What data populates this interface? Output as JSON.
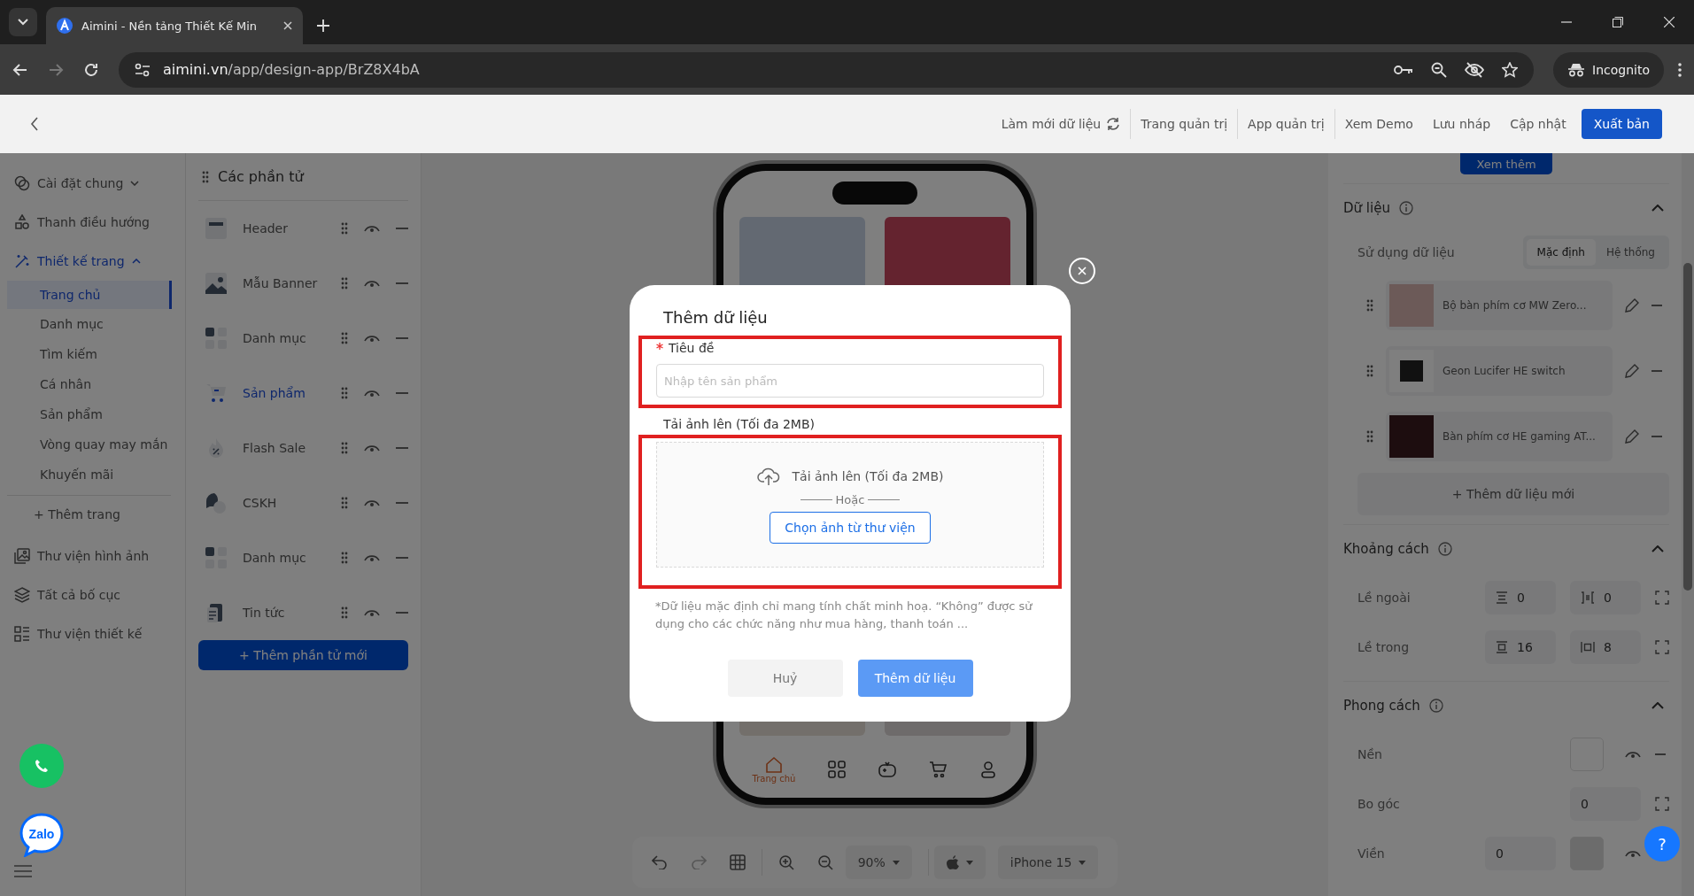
{
  "browser": {
    "tabs": [
      {
        "title": "Aimini - Nền tảng Thiết Kế Min",
        "selected": true
      }
    ],
    "url_host": "aimini.vn",
    "url_path": "/app/design-app/BrZ8X4bA",
    "profile": "Incognito"
  },
  "header": {
    "actions": [
      {
        "label": "Làm mới dữ liệu",
        "kind": "refresh",
        "divider": true
      },
      {
        "label": "Trang quản trị",
        "kind": "link",
        "divider": true
      },
      {
        "label": "App quản trị",
        "kind": "link",
        "divider": true
      },
      {
        "label": "Xem Demo",
        "kind": "link",
        "divider": false
      },
      {
        "label": "Lưu nháp",
        "kind": "link",
        "divider": false
      },
      {
        "label": "Cập nhật",
        "kind": "link",
        "divider": false
      },
      {
        "label": "Xuất bản",
        "kind": "primary",
        "divider": false
      }
    ]
  },
  "sidebar": {
    "items": [
      {
        "label": "Cài đặt chung",
        "expanded": false,
        "selected": false
      },
      {
        "label": "Thanh điều hướng",
        "selected": false
      },
      {
        "label": "Thiết kế trang",
        "expanded": true,
        "selected": true,
        "add_label": "+ Thêm trang",
        "children": [
          {
            "label": "Trang chủ",
            "selected": true
          },
          {
            "label": "Danh mục",
            "selected": false
          },
          {
            "label": "Tìm kiếm",
            "selected": false
          },
          {
            "label": "Cá nhân",
            "selected": false
          },
          {
            "label": "Sản phẩm",
            "selected": false
          },
          {
            "label": "Vòng quay may mắn",
            "selected": false
          },
          {
            "label": "Khuyến mãi",
            "selected": false
          }
        ]
      },
      {
        "label": "Thư viện hình ảnh",
        "selected": false
      },
      {
        "label": "Tất cả bố cục",
        "selected": false
      },
      {
        "label": "Thư viện thiết kế",
        "selected": false
      }
    ]
  },
  "elements": {
    "title": "Các phần tử",
    "items": [
      {
        "label": "Header",
        "kind": "header",
        "selected": false
      },
      {
        "label": "Mẫu Banner",
        "kind": "banner",
        "selected": false
      },
      {
        "label": "Danh mục",
        "kind": "category",
        "selected": false
      },
      {
        "label": "Sản phẩm",
        "kind": "product",
        "selected": true
      },
      {
        "label": "Flash Sale",
        "kind": "sale",
        "selected": false
      },
      {
        "label": "CSKH",
        "kind": "support",
        "selected": false
      },
      {
        "label": "Danh mục",
        "kind": "category",
        "selected": false
      },
      {
        "label": "Tin tức",
        "kind": "news",
        "selected": false
      }
    ],
    "add_button": "+ Thêm phần tử mới"
  },
  "floating": {
    "chat_label": "Zalo",
    "help": "?"
  },
  "canvas": {
    "phone_nav": [
      {
        "label": "Trang chủ",
        "selected": true
      },
      {
        "selected": false
      },
      {
        "selected": false
      },
      {
        "selected": false
      },
      {
        "selected": false
      }
    ],
    "toolbar": {
      "zoom": "90%",
      "device": "iPhone 15"
    }
  },
  "modal": {
    "title": "Thêm dữ liệu",
    "title_field": {
      "label": "Tiêu đề",
      "required": true,
      "placeholder": "Nhập tên sản phẩm"
    },
    "upload": {
      "label": "Tải ảnh lên (Tối đa 2MB)",
      "prompt": "Tải ảnh lên (Tối đa 2MB)",
      "divider": "Hoặc",
      "library_button": "Chọn ảnh từ thư viện"
    },
    "note": "*Dữ liệu mặc định chỉ mang tính chất minh hoạ. “Không” được sử dụng cho các chức năng như mua hàng, thanh toán ...",
    "cancel": "Huỷ",
    "submit": "Thêm dữ liệu"
  },
  "right": {
    "more_button": "Xem thêm",
    "data": {
      "title": "Dữ liệu",
      "expanded": true,
      "source_label": "Sử dụng dữ liệu",
      "sources": [
        {
          "label": "Mặc định",
          "selected": true
        },
        {
          "label": "Hệ thống",
          "selected": false
        }
      ],
      "items": [
        {
          "name": "Bộ bàn phím cơ MW Zero..."
        },
        {
          "name": "Geon Lucifer HE switch"
        },
        {
          "name": "Bàn phím cơ HE gaming AT..."
        }
      ],
      "add_button": "+ Thêm dữ liệu mới"
    },
    "spacing": {
      "title": "Khoảng cách",
      "expanded": true,
      "rows": [
        {
          "label": "Lề ngoài",
          "fields": [
            {
              "kind": "margin-y",
              "value": "0"
            },
            {
              "kind": "margin-x",
              "value": "0"
            }
          ]
        },
        {
          "label": "Lề trong",
          "fields": [
            {
              "kind": "padding-y",
              "value": "16"
            },
            {
              "kind": "padding-x",
              "value": "8"
            }
          ]
        }
      ]
    },
    "style": {
      "title": "Phong cách",
      "expanded": true,
      "rows": [
        {
          "label": "Nền",
          "kind": "color"
        },
        {
          "label": "Bo góc",
          "kind": "number",
          "value": "0"
        },
        {
          "label": "Viền",
          "kind": "border",
          "value": "0"
        }
      ]
    }
  }
}
